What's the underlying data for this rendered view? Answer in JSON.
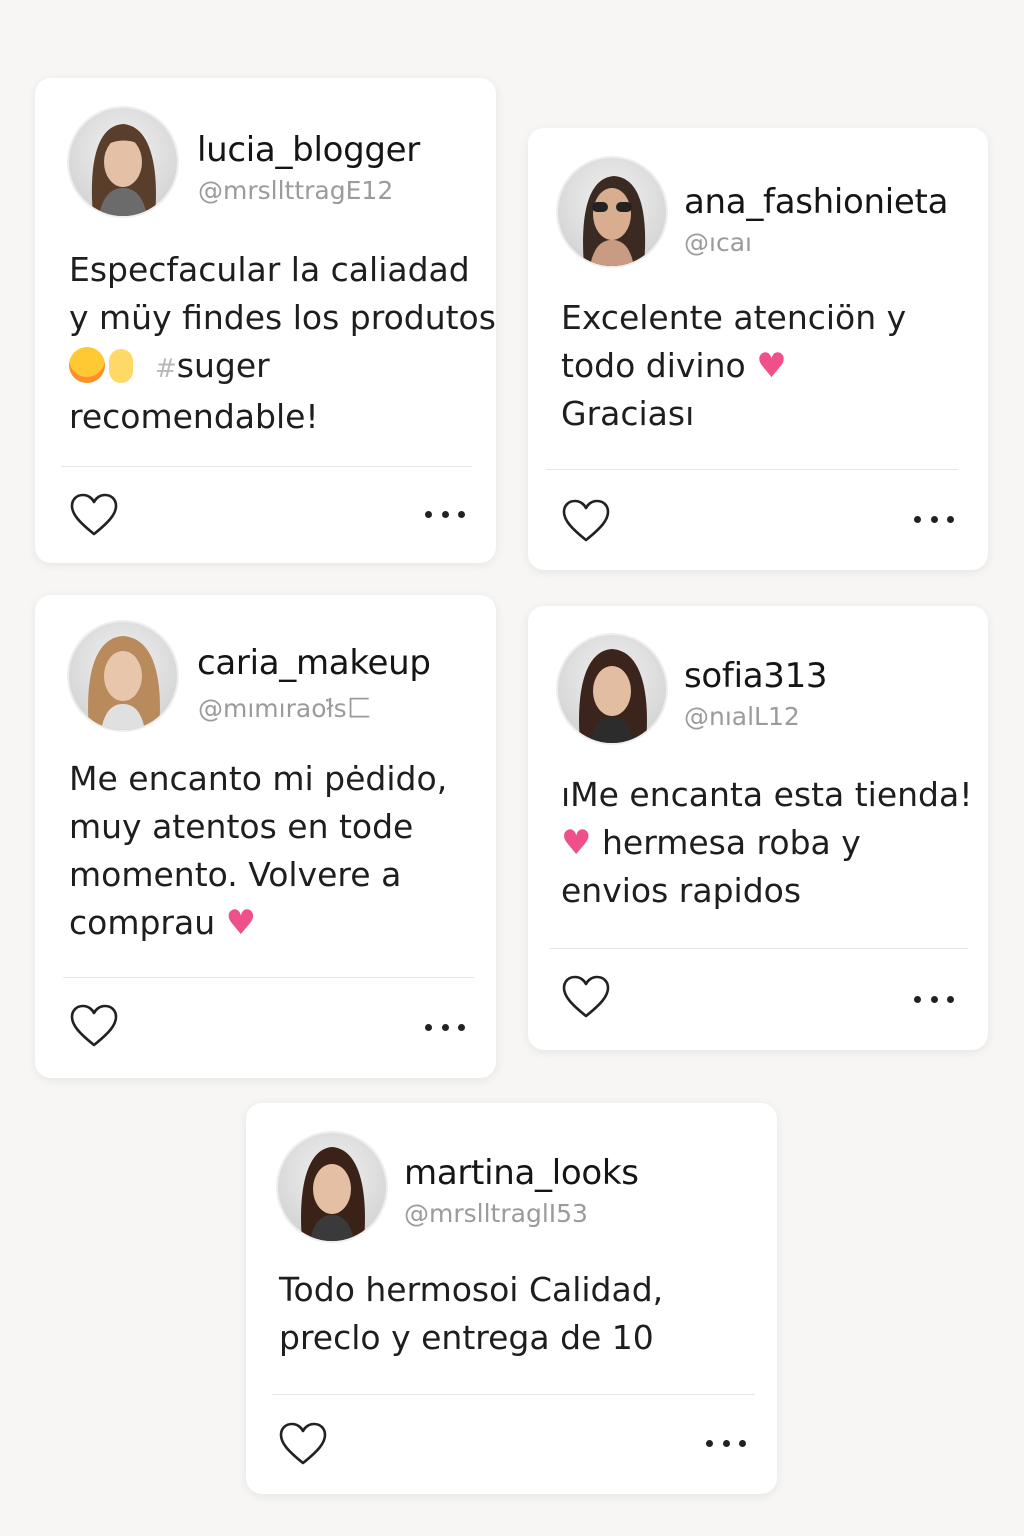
{
  "colors": {
    "background": "#f7f6f4",
    "card": "#ffffff",
    "handle_text": "#9b9b9b",
    "heart_emoji": "#f0508a",
    "icon": "#222222"
  },
  "posts": [
    {
      "username": "lucia_blogger",
      "handle": "@mrsllttragE12",
      "lines": [
        "Especfacular la caliadad",
        "y müy findes los produtos",
        "suger",
        "recomendable!"
      ],
      "tag_prefix": "#",
      "like_icon": "heart-outline-icon",
      "more_icon": "more-dots-icon"
    },
    {
      "username": "ana_fashionieta",
      "handle": "@ıcaı",
      "lines": [
        "Excelente atenciön y",
        "todo divino",
        "Graciası"
      ],
      "emoji": "♥",
      "like_icon": "heart-outline-icon",
      "more_icon": "more-dots-icon"
    },
    {
      "username": "caria_makeup",
      "handle": "@mımıraoł̇s匚",
      "lines": [
        "Me encanto mi pėdido,",
        "muy atentos en tode",
        "momento. Volvere a",
        "comprau"
      ],
      "emoji": "♥",
      "like_icon": "heart-outline-icon",
      "more_icon": "more-dots-icon"
    },
    {
      "username": "sofia313",
      "handle": "@nıalL12",
      "lines": [
        "ıMe encanta esta tienda!",
        "hermesa roba y",
        "envios rapidos"
      ],
      "emoji": "♥",
      "like_icon": "heart-outline-icon",
      "more_icon": "more-dots-icon"
    },
    {
      "username": "martina_looks",
      "handle": "@mrslltraglI53",
      "lines": [
        "Todo hermosoi Calidad,",
        "preclo y entrega de 10"
      ],
      "like_icon": "heart-outline-icon",
      "more_icon": "more-dots-icon"
    }
  ]
}
